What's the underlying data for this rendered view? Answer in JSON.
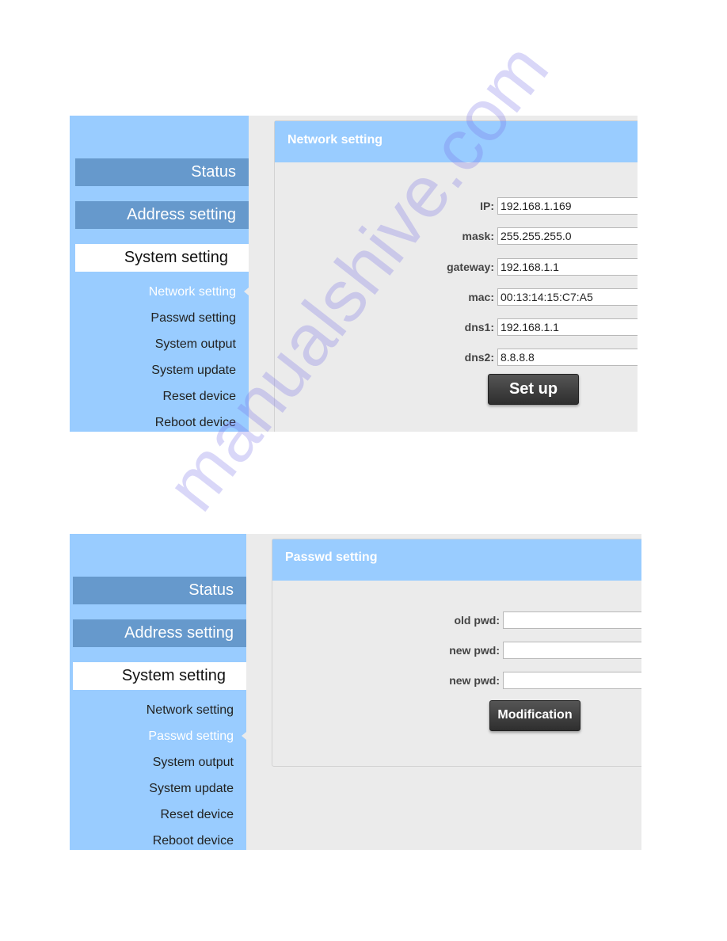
{
  "colors": {
    "sidebar_bg": "#99ccff",
    "nav_main_bg": "#6699cc",
    "panel_header_bg": "#99ccff",
    "button_bg": "#3a3a3a",
    "content_bg": "#ebebeb"
  },
  "screens": [
    {
      "sidebar": {
        "main": [
          {
            "label": "Status",
            "active": false
          },
          {
            "label": "Address setting",
            "active": false
          },
          {
            "label": "System setting",
            "active": true
          }
        ],
        "sub": [
          {
            "label": "Network setting",
            "active": true
          },
          {
            "label": "Passwd setting",
            "active": false
          },
          {
            "label": "System output",
            "active": false
          },
          {
            "label": "System update",
            "active": false
          },
          {
            "label": "Reset device",
            "active": false
          },
          {
            "label": "Reboot device",
            "active": false
          }
        ]
      },
      "panel": {
        "title": "Network setting",
        "fields": [
          {
            "label": "IP:",
            "value": "192.168.1.169"
          },
          {
            "label": "mask:",
            "value": "255.255.255.0"
          },
          {
            "label": "gateway:",
            "value": "192.168.1.1"
          },
          {
            "label": "mac:",
            "value": "00:13:14:15:C7:A5"
          },
          {
            "label": "dns1:",
            "value": "192.168.1.1"
          },
          {
            "label": "dns2:",
            "value": "8.8.8.8"
          }
        ],
        "button": "Set up"
      }
    },
    {
      "sidebar": {
        "main": [
          {
            "label": "Status",
            "active": false
          },
          {
            "label": "Address setting",
            "active": false
          },
          {
            "label": "System setting",
            "active": true
          }
        ],
        "sub": [
          {
            "label": "Network setting",
            "active": false
          },
          {
            "label": "Passwd setting",
            "active": true
          },
          {
            "label": "System output",
            "active": false
          },
          {
            "label": "System update",
            "active": false
          },
          {
            "label": "Reset device",
            "active": false
          },
          {
            "label": "Reboot device",
            "active": false
          }
        ]
      },
      "panel": {
        "title": "Passwd setting",
        "fields": [
          {
            "label": "old pwd:",
            "value": ""
          },
          {
            "label": "new pwd:",
            "value": ""
          },
          {
            "label": "new pwd:",
            "value": ""
          }
        ],
        "button": "Modification"
      }
    }
  ],
  "watermark": "manualshive.com"
}
